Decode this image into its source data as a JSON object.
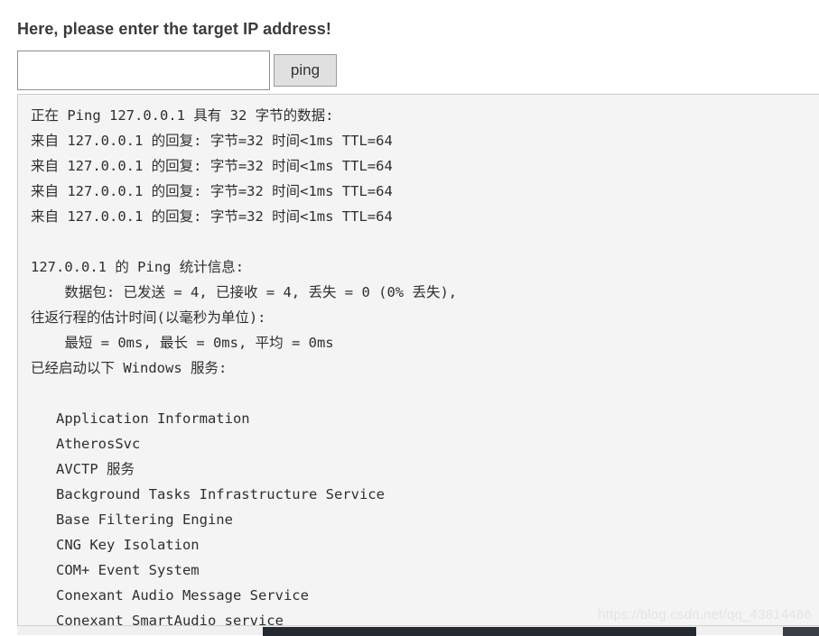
{
  "page": {
    "title": "Here, please enter the target IP address!"
  },
  "form": {
    "ip_input_value": "",
    "ip_input_placeholder": "",
    "ping_button_label": "ping"
  },
  "output": {
    "text": "正在 Ping 127.0.0.1 具有 32 字节的数据:\n来自 127.0.0.1 的回复: 字节=32 时间<1ms TTL=64\n来自 127.0.0.1 的回复: 字节=32 时间<1ms TTL=64\n来自 127.0.0.1 的回复: 字节=32 时间<1ms TTL=64\n来自 127.0.0.1 的回复: 字节=32 时间<1ms TTL=64\n\n127.0.0.1 的 Ping 统计信息:\n    数据包: 已发送 = 4, 已接收 = 4, 丢失 = 0 (0% 丢失),\n往返行程的估计时间(以毫秒为单位):\n    最短 = 0ms, 最长 = 0ms, 平均 = 0ms\n已经启动以下 Windows 服务:\n\n   Application Information\n   AtherosSvc\n   AVCTP 服务\n   Background Tasks Infrastructure Service\n   Base Filtering Engine\n   CNG Key Isolation\n   COM+ Event System\n   Conexant Audio Message Service\n   Conexant SmartAudio service",
    "ping_target": "127.0.0.1",
    "ping_data_bytes": "32",
    "replies": [
      {
        "from": "127.0.0.1",
        "bytes": "32",
        "time": "<1ms",
        "ttl": "64"
      },
      {
        "from": "127.0.0.1",
        "bytes": "32",
        "time": "<1ms",
        "ttl": "64"
      },
      {
        "from": "127.0.0.1",
        "bytes": "32",
        "time": "<1ms",
        "ttl": "64"
      },
      {
        "from": "127.0.0.1",
        "bytes": "32",
        "time": "<1ms",
        "ttl": "64"
      }
    ],
    "statistics": {
      "sent": "4",
      "received": "4",
      "lost": "0",
      "lost_percent": "0%",
      "minimum": "0ms",
      "maximum": "0ms",
      "average": "0ms"
    },
    "services": [
      "Application Information",
      "AtherosSvc",
      "AVCTP 服务",
      "Background Tasks Infrastructure Service",
      "Base Filtering Engine",
      "CNG Key Isolation",
      "COM+ Event System",
      "Conexant Audio Message Service",
      "Conexant SmartAudio service"
    ]
  },
  "watermark": {
    "text": "https://blog.csdn.net/qq_43814486"
  },
  "colors": {
    "panel_background": "#f4f4f4",
    "panel_border": "#c9c9c9",
    "text": "#2f2f2f",
    "title": "#3b3b3b",
    "button_background": "#e0e0e0",
    "scrollbar_thumb": "#252a32"
  }
}
